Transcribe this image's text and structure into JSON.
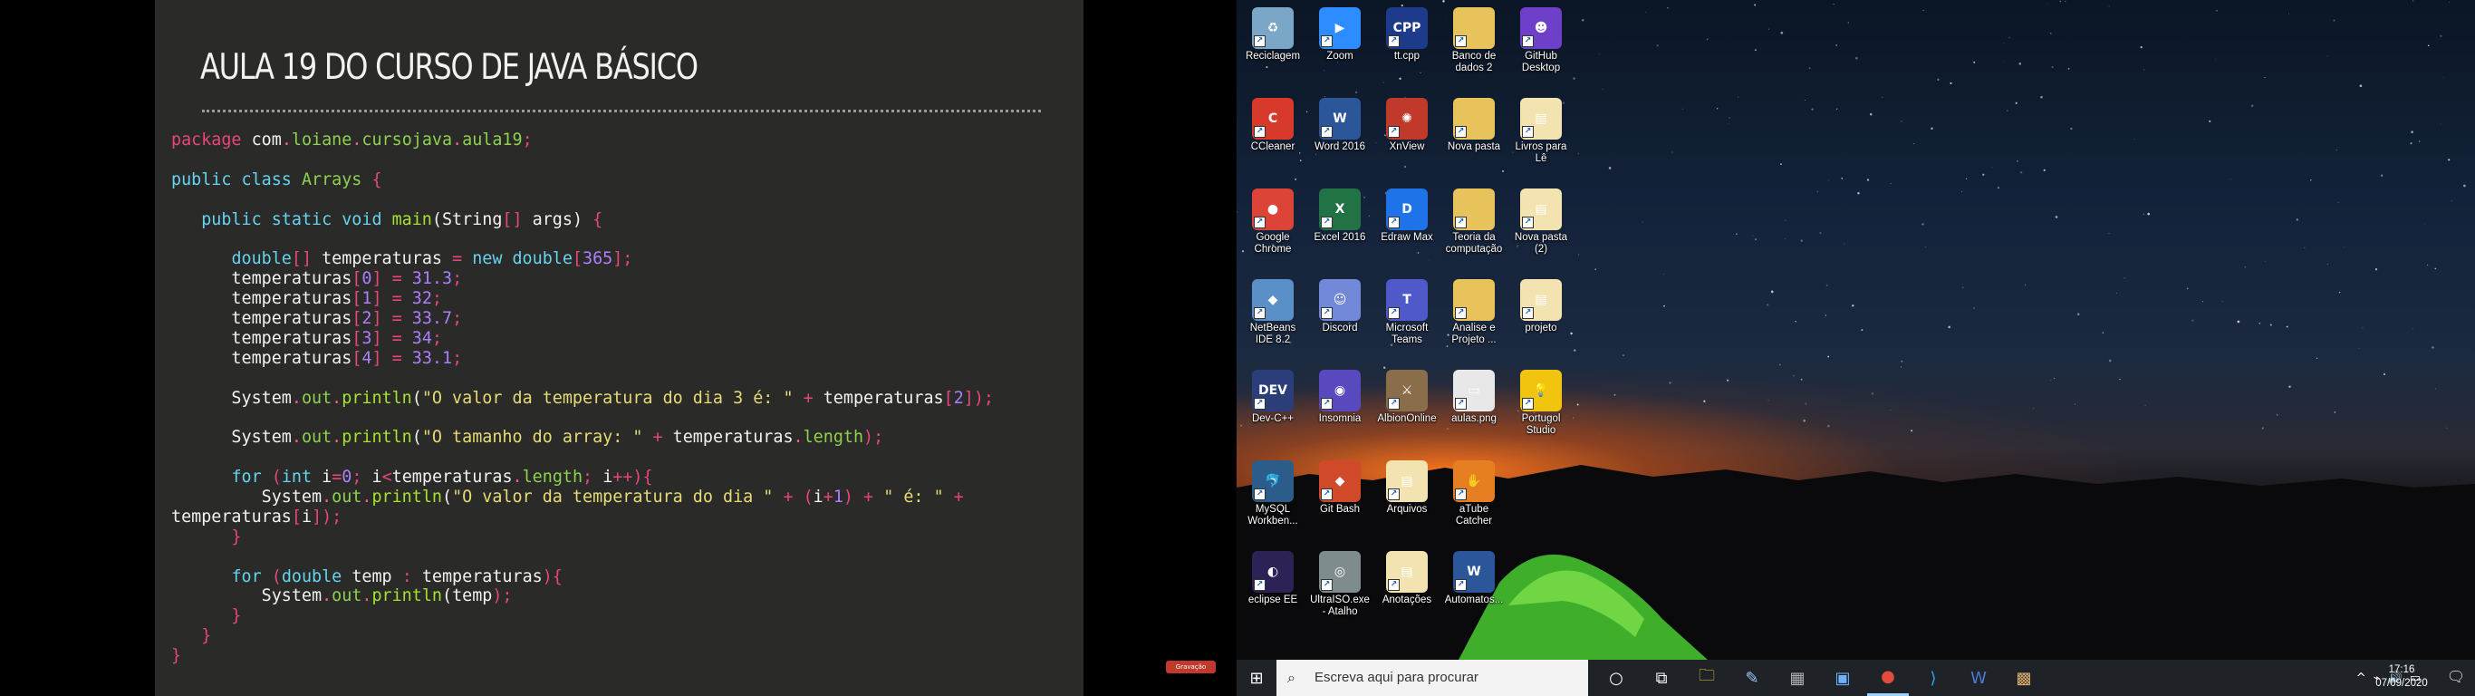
{
  "slide": {
    "title": "AULA 19 DO CURSO DE JAVA BÁSICO",
    "code_lines": [
      [
        [
          "kw",
          "package"
        ],
        [
          "plain",
          " com"
        ],
        [
          "dot",
          "."
        ],
        [
          "cls",
          "loiane"
        ],
        [
          "dot",
          "."
        ],
        [
          "cls",
          "cursojava"
        ],
        [
          "dot",
          "."
        ],
        [
          "cls",
          "aula19"
        ],
        [
          "pun",
          ";"
        ]
      ],
      [],
      [
        [
          "type",
          "public class "
        ],
        [
          "cls",
          "Arrays"
        ],
        [
          "pun",
          " {"
        ]
      ],
      [],
      [
        [
          "plain",
          "   "
        ],
        [
          "type",
          "public static void "
        ],
        [
          "fn",
          "main"
        ],
        [
          "plain",
          "("
        ],
        [
          "plain",
          "String"
        ],
        [
          "pun",
          "[]"
        ],
        [
          "plain",
          " args"
        ],
        [
          "plain",
          ")"
        ],
        [
          "pun",
          " {"
        ]
      ],
      [],
      [
        [
          "plain",
          "      "
        ],
        [
          "type",
          "double"
        ],
        [
          "pun",
          "[]"
        ],
        [
          "plain",
          " temperaturas "
        ],
        [
          "pun",
          "="
        ],
        [
          "type",
          " new double"
        ],
        [
          "pun",
          "["
        ],
        [
          "num",
          "365"
        ],
        [
          "pun",
          "];"
        ]
      ],
      [
        [
          "plain",
          "      temperaturas"
        ],
        [
          "pun",
          "["
        ],
        [
          "num",
          "0"
        ],
        [
          "pun",
          "]"
        ],
        [
          "pun",
          " = "
        ],
        [
          "num",
          "31.3"
        ],
        [
          "pun",
          ";"
        ]
      ],
      [
        [
          "plain",
          "      temperaturas"
        ],
        [
          "pun",
          "["
        ],
        [
          "num",
          "1"
        ],
        [
          "pun",
          "]"
        ],
        [
          "pun",
          " = "
        ],
        [
          "num",
          "32"
        ],
        [
          "pun",
          ";"
        ]
      ],
      [
        [
          "plain",
          "      temperaturas"
        ],
        [
          "pun",
          "["
        ],
        [
          "num",
          "2"
        ],
        [
          "pun",
          "]"
        ],
        [
          "pun",
          " = "
        ],
        [
          "num",
          "33.7"
        ],
        [
          "pun",
          ";"
        ]
      ],
      [
        [
          "plain",
          "      temperaturas"
        ],
        [
          "pun",
          "["
        ],
        [
          "num",
          "3"
        ],
        [
          "pun",
          "]"
        ],
        [
          "pun",
          " = "
        ],
        [
          "num",
          "34"
        ],
        [
          "pun",
          ";"
        ]
      ],
      [
        [
          "plain",
          "      temperaturas"
        ],
        [
          "pun",
          "["
        ],
        [
          "num",
          "4"
        ],
        [
          "pun",
          "]"
        ],
        [
          "pun",
          " = "
        ],
        [
          "num",
          "33.1"
        ],
        [
          "pun",
          ";"
        ]
      ],
      [],
      [
        [
          "plain",
          "      System"
        ],
        [
          "dot",
          "."
        ],
        [
          "cls",
          "out"
        ],
        [
          "dot",
          "."
        ],
        [
          "fn",
          "println"
        ],
        [
          "plain",
          "("
        ],
        [
          "str",
          "\"O valor da temperatura do dia 3 é: \""
        ],
        [
          "pun",
          " + "
        ],
        [
          "plain",
          "temperaturas"
        ],
        [
          "pun",
          "["
        ],
        [
          "num",
          "2"
        ],
        [
          "pun",
          "]);"
        ]
      ],
      [],
      [
        [
          "plain",
          "      System"
        ],
        [
          "dot",
          "."
        ],
        [
          "cls",
          "out"
        ],
        [
          "dot",
          "."
        ],
        [
          "fn",
          "println"
        ],
        [
          "plain",
          "("
        ],
        [
          "str",
          "\"O tamanho do array: \""
        ],
        [
          "pun",
          " + "
        ],
        [
          "plain",
          "temperaturas"
        ],
        [
          "dot",
          "."
        ],
        [
          "cls",
          "length"
        ],
        [
          "pun",
          ");"
        ]
      ],
      [],
      [
        [
          "plain",
          "      "
        ],
        [
          "type",
          "for"
        ],
        [
          "pun",
          " ("
        ],
        [
          "type",
          "int"
        ],
        [
          "plain",
          " i"
        ],
        [
          "pun",
          "="
        ],
        [
          "num",
          "0"
        ],
        [
          "pun",
          "; "
        ],
        [
          "plain",
          "i"
        ],
        [
          "pun",
          "<"
        ],
        [
          "plain",
          "temperaturas"
        ],
        [
          "dot",
          "."
        ],
        [
          "cls",
          "length"
        ],
        [
          "pun",
          "; "
        ],
        [
          "plain",
          "i"
        ],
        [
          "pun",
          "++){"
        ]
      ],
      [
        [
          "plain",
          "         System"
        ],
        [
          "dot",
          "."
        ],
        [
          "cls",
          "out"
        ],
        [
          "dot",
          "."
        ],
        [
          "fn",
          "println"
        ],
        [
          "plain",
          "("
        ],
        [
          "str",
          "\"O valor da temperatura do dia \""
        ],
        [
          "pun",
          " + ("
        ],
        [
          "plain",
          "i"
        ],
        [
          "pun",
          "+"
        ],
        [
          "num",
          "1"
        ],
        [
          "pun",
          ")"
        ],
        [
          "pun",
          " + "
        ],
        [
          "str",
          "\" é: \""
        ],
        [
          "pun",
          " +"
        ]
      ],
      [
        [
          "plain",
          "temperaturas"
        ],
        [
          "pun",
          "["
        ],
        [
          "plain",
          "i"
        ],
        [
          "pun",
          "]);"
        ]
      ],
      [
        [
          "pun",
          "      }"
        ]
      ],
      [],
      [
        [
          "plain",
          "      "
        ],
        [
          "type",
          "for"
        ],
        [
          "pun",
          " ("
        ],
        [
          "type",
          "double"
        ],
        [
          "plain",
          " temp "
        ],
        [
          "pun",
          ": "
        ],
        [
          "plain",
          "temperaturas"
        ],
        [
          "pun",
          "){"
        ]
      ],
      [
        [
          "plain",
          "         System"
        ],
        [
          "dot",
          "."
        ],
        [
          "cls",
          "out"
        ],
        [
          "dot",
          "."
        ],
        [
          "fn",
          "println"
        ],
        [
          "plain",
          "("
        ],
        [
          "plain",
          "temp"
        ],
        [
          "pun",
          ");"
        ]
      ],
      [
        [
          "pun",
          "      }"
        ]
      ],
      [
        [
          "pun",
          "   }"
        ]
      ],
      [
        [
          "pun",
          "}"
        ]
      ]
    ]
  },
  "recording_badge": "Gravação",
  "desktop": {
    "icons": [
      {
        "label": "Reciclagem",
        "icon": "recycle-bin-icon",
        "color": "#7aa7c7",
        "glyph": "♻"
      },
      {
        "label": "Zoom",
        "icon": "zoom-icon",
        "color": "#2d8cff",
        "glyph": "▶"
      },
      {
        "label": "tt.cpp",
        "icon": "cpp-file-icon",
        "color": "#1e3a8a",
        "glyph": "CPP"
      },
      {
        "label": "Banco de dados 2",
        "icon": "folder-icon",
        "color": "#e8c25a",
        "glyph": ""
      },
      {
        "label": "GitHub Desktop",
        "icon": "github-desktop-icon",
        "color": "#6e40c9",
        "glyph": "☻"
      },
      {
        "label": "CCleaner",
        "icon": "ccleaner-icon",
        "color": "#d73a2a",
        "glyph": "C"
      },
      {
        "label": "Word 2016",
        "icon": "word-icon",
        "color": "#2b579a",
        "glyph": "W"
      },
      {
        "label": "XnView",
        "icon": "xnview-icon",
        "color": "#c0392b",
        "glyph": "✺"
      },
      {
        "label": "Nova pasta",
        "icon": "folder-icon",
        "color": "#e8c25a",
        "glyph": ""
      },
      {
        "label": "Livros para Lê",
        "icon": "folder-pdf-icon",
        "color": "#f2e3b0",
        "glyph": "▤"
      },
      {
        "label": "Google Chrome",
        "icon": "chrome-icon",
        "color": "#db4437",
        "glyph": "●"
      },
      {
        "label": "Excel 2016",
        "icon": "excel-icon",
        "color": "#217346",
        "glyph": "X"
      },
      {
        "label": "Edraw Max",
        "icon": "edraw-icon",
        "color": "#1e73e8",
        "glyph": "D"
      },
      {
        "label": "Teoria da computação",
        "icon": "folder-icon",
        "color": "#e8c25a",
        "glyph": ""
      },
      {
        "label": "Nova pasta (2)",
        "icon": "folder-doc-icon",
        "color": "#f2e3b0",
        "glyph": "▤"
      },
      {
        "label": "NetBeans IDE 8.2",
        "icon": "netbeans-icon",
        "color": "#5b8fc7",
        "glyph": "◆"
      },
      {
        "label": "Discord",
        "icon": "discord-icon",
        "color": "#7289da",
        "glyph": "☺"
      },
      {
        "label": "Microsoft Teams",
        "icon": "teams-icon",
        "color": "#5059c9",
        "glyph": "T"
      },
      {
        "label": "Analise e Projeto ...",
        "icon": "folder-icon",
        "color": "#e8c25a",
        "glyph": ""
      },
      {
        "label": "projeto",
        "icon": "folder-doc-icon",
        "color": "#f2e3b0",
        "glyph": "▤"
      },
      {
        "label": "Dev-C++",
        "icon": "devcpp-icon",
        "color": "#2c3e7a",
        "glyph": "DEV"
      },
      {
        "label": "Insomnia",
        "icon": "insomnia-icon",
        "color": "#5849be",
        "glyph": "◉"
      },
      {
        "label": "AlbionOnline",
        "icon": "albion-icon",
        "color": "#8a6d4a",
        "glyph": "⚔"
      },
      {
        "label": "aulas.png",
        "icon": "image-file-icon",
        "color": "#e8e8e8",
        "glyph": "▭"
      },
      {
        "label": "Portugol Studio",
        "icon": "portugol-icon",
        "color": "#f1c40f",
        "glyph": "💡"
      },
      {
        "label": "MySQL Workben...",
        "icon": "mysql-icon",
        "color": "#2c5d8a",
        "glyph": "🐬"
      },
      {
        "label": "Git Bash",
        "icon": "git-bash-icon",
        "color": "#d04a2a",
        "glyph": "◆"
      },
      {
        "label": "Arquivos",
        "icon": "folder-pdf-icon",
        "color": "#f2e3b0",
        "glyph": "▤"
      },
      {
        "label": "aTube Catcher",
        "icon": "atube-icon",
        "color": "#e67e22",
        "glyph": "✋"
      },
      {
        "label": "",
        "icon": "empty",
        "color": "transparent",
        "glyph": ""
      },
      {
        "label": "eclipse EE",
        "icon": "eclipse-icon",
        "color": "#2c2255",
        "glyph": "◐"
      },
      {
        "label": "UltraISO.exe - Atalho",
        "icon": "ultraiso-icon",
        "color": "#7f8c8d",
        "glyph": "◎"
      },
      {
        "label": "Anotações",
        "icon": "folder-doc-icon",
        "color": "#f2e3b0",
        "glyph": "▤"
      },
      {
        "label": "Automatos...",
        "icon": "word-doc-icon",
        "color": "#2b579a",
        "glyph": "W"
      }
    ]
  },
  "taskbar": {
    "start_glyph": "⊞",
    "search_placeholder": "Escreva aqui para procurar",
    "search_glyph": "⌕",
    "buttons": [
      {
        "name": "cortana-button",
        "glyph": "○",
        "color": "#ffffff"
      },
      {
        "name": "task-view-button",
        "glyph": "⧉",
        "color": "#ffffff"
      },
      {
        "name": "file-explorer-button",
        "glyph": "🗀",
        "color": "#f3c242"
      },
      {
        "name": "paint-button",
        "glyph": "✎",
        "color": "#9ec7ff"
      },
      {
        "name": "calculator-button",
        "glyph": "▦",
        "color": "#b0b0b0"
      },
      {
        "name": "photos-button",
        "glyph": "▣",
        "color": "#6fb0ff"
      },
      {
        "name": "chrome-button",
        "glyph": "●",
        "color": "#e34c3c"
      },
      {
        "name": "vscode-button",
        "glyph": "⟩",
        "color": "#2fa3f2"
      },
      {
        "name": "word-button",
        "glyph": "W",
        "color": "#4a7ad0"
      },
      {
        "name": "app-button",
        "glyph": "▩",
        "color": "#e0b070"
      }
    ],
    "tray": {
      "chevron": "^",
      "network": "⌁",
      "volume": "🔊",
      "battery": "▭"
    },
    "clock_time": "17:16",
    "clock_date": "07/09/2020",
    "notification_glyph": "🗨"
  }
}
